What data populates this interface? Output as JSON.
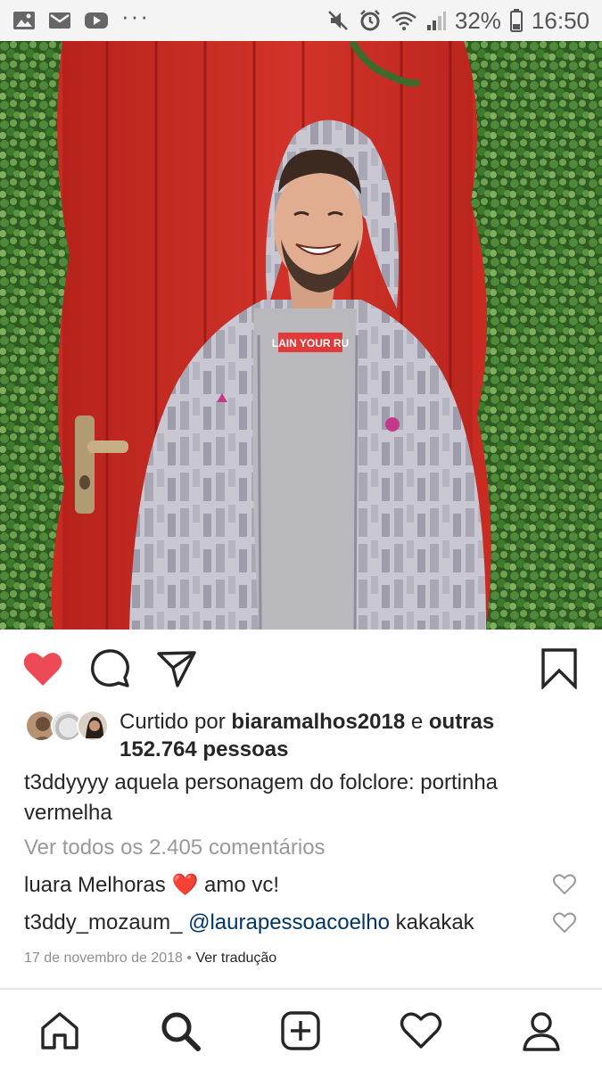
{
  "status_bar": {
    "battery_percent": "32%",
    "time": "16:50",
    "left_icons": [
      "image-icon",
      "mail-icon",
      "youtube-icon",
      "more-dots-icon"
    ],
    "right_icons": [
      "mute-icon",
      "alarm-icon",
      "wifi-icon",
      "signal-icon",
      "battery-icon"
    ]
  },
  "post": {
    "photo": {
      "shirt_text": "LAIN YOUR RU"
    },
    "actions": {
      "liked": true,
      "like_color": "#ed4956",
      "icons": [
        "heart-icon",
        "comment-icon",
        "share-icon",
        "bookmark-icon"
      ]
    },
    "likes": {
      "prefix": "Curtido por",
      "liker": "biaramalhos2018",
      "conjunction": "e",
      "others_label": "outras",
      "others_count": "152.764 pessoas"
    },
    "caption": {
      "username": "t3ddyyyy",
      "text": "aquela personagem do folclore: portinha vermelha"
    },
    "view_all_comments": "Ver todos os 2.405 comentários",
    "comments": [
      {
        "username": "luara",
        "text_before": "Melhoras",
        "emoji": "❤️",
        "text_after": "amo vc!"
      },
      {
        "username": "t3ddy_mozaum_",
        "mention": "@laurapessoacoelho",
        "text_after": "kakakak"
      }
    ],
    "date": "17 de novembro de 2018",
    "separator": "•",
    "translate_label": "Ver tradução"
  },
  "bottom_nav": {
    "items": [
      "home-icon",
      "search-icon",
      "add-post-icon",
      "activity-heart-icon",
      "profile-icon"
    ],
    "active": "search-icon"
  },
  "colors": {
    "mention": "#003569",
    "muted": "#999999",
    "door_red": "#c4261c",
    "ivy_green": "#3e6b2c"
  }
}
